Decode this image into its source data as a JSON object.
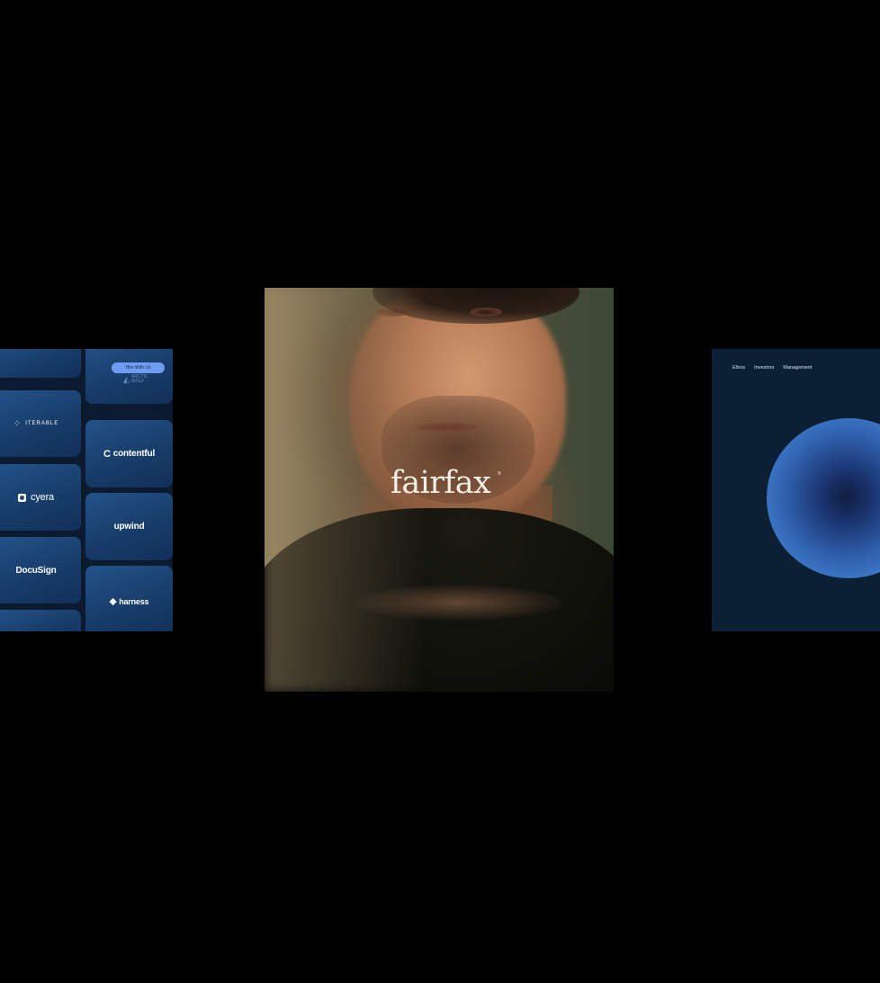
{
  "left_card": {
    "hire_button": "Hire With Us",
    "arctic_logo": "ARCTIC WOLF",
    "tiles": [
      {
        "label": "ITERABLE",
        "icon": "iterable-logo-icon"
      },
      {
        "label": "contentful",
        "icon": "contentful-logo-icon"
      },
      {
        "label": "cyera",
        "icon": "cyera-logo-icon"
      },
      {
        "label": "upwind",
        "icon": "upwind-logo-icon"
      },
      {
        "label": "DocuSign",
        "icon": "docusign-logo-icon"
      },
      {
        "label": "harness",
        "icon": "harness-logo-icon"
      }
    ],
    "colors": {
      "tile": "#1c4677",
      "background": "#0b1a2e",
      "pill": "#6f9cf0"
    }
  },
  "center_card": {
    "brand": "fairfax",
    "mark": "®",
    "image": "portrait-photo",
    "colors": {
      "text": "#f4efe6"
    }
  },
  "right_card": {
    "nav": [
      "Ethos",
      "Investors",
      "Management"
    ],
    "colors": {
      "background": "#0b1f35",
      "orb_outer": "#4a8ee0",
      "orb_core": "#101d40"
    }
  }
}
